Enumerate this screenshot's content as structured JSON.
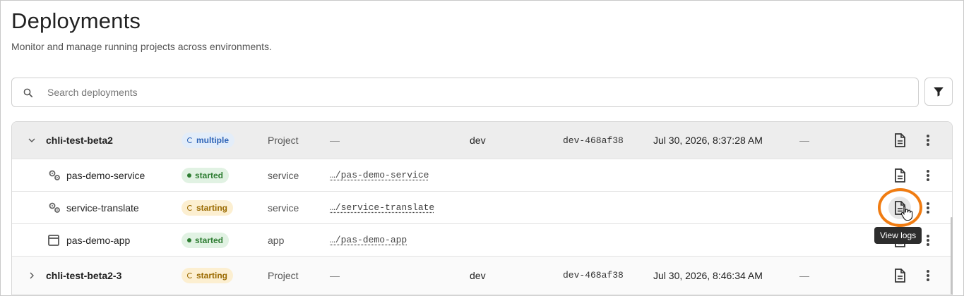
{
  "page": {
    "title": "Deployments",
    "subtitle": "Monitor and manage running projects across environments."
  },
  "search": {
    "placeholder": "Search deployments"
  },
  "rows": [
    {
      "name": "chli-test-beta2",
      "status": "multiple",
      "type": "Project",
      "path": "—",
      "env": "dev",
      "id": "dev-468af38",
      "date": "Jul 30, 2026, 8:37:28 AM",
      "extra": "—"
    },
    {
      "name": "pas-demo-service",
      "status": "started",
      "type": "service",
      "path": "…/pas-demo-service"
    },
    {
      "name": "service-translate",
      "status": "starting",
      "type": "service",
      "path": "…/service-translate"
    },
    {
      "name": "pas-demo-app",
      "status": "started",
      "type": "app",
      "path": "…/pas-demo-app"
    },
    {
      "name": "chli-test-beta2-3",
      "status": "starting",
      "type": "Project",
      "path": "—",
      "env": "dev",
      "id": "dev-468af38",
      "date": "Jul 30, 2026, 8:46:34 AM",
      "extra": "—"
    }
  ],
  "tooltip": "View logs",
  "colors": {
    "accent_ring": "#f07c12",
    "started": "#2e7d32",
    "starting": "#9a6a00",
    "multiple": "#2e64b8"
  },
  "icons": {
    "search": "search-icon",
    "filter": "filter-icon",
    "logs": "document-icon",
    "more": "more-vertical-icon",
    "service": "gears-icon",
    "app": "window-icon",
    "expand": "chevron-icon"
  }
}
